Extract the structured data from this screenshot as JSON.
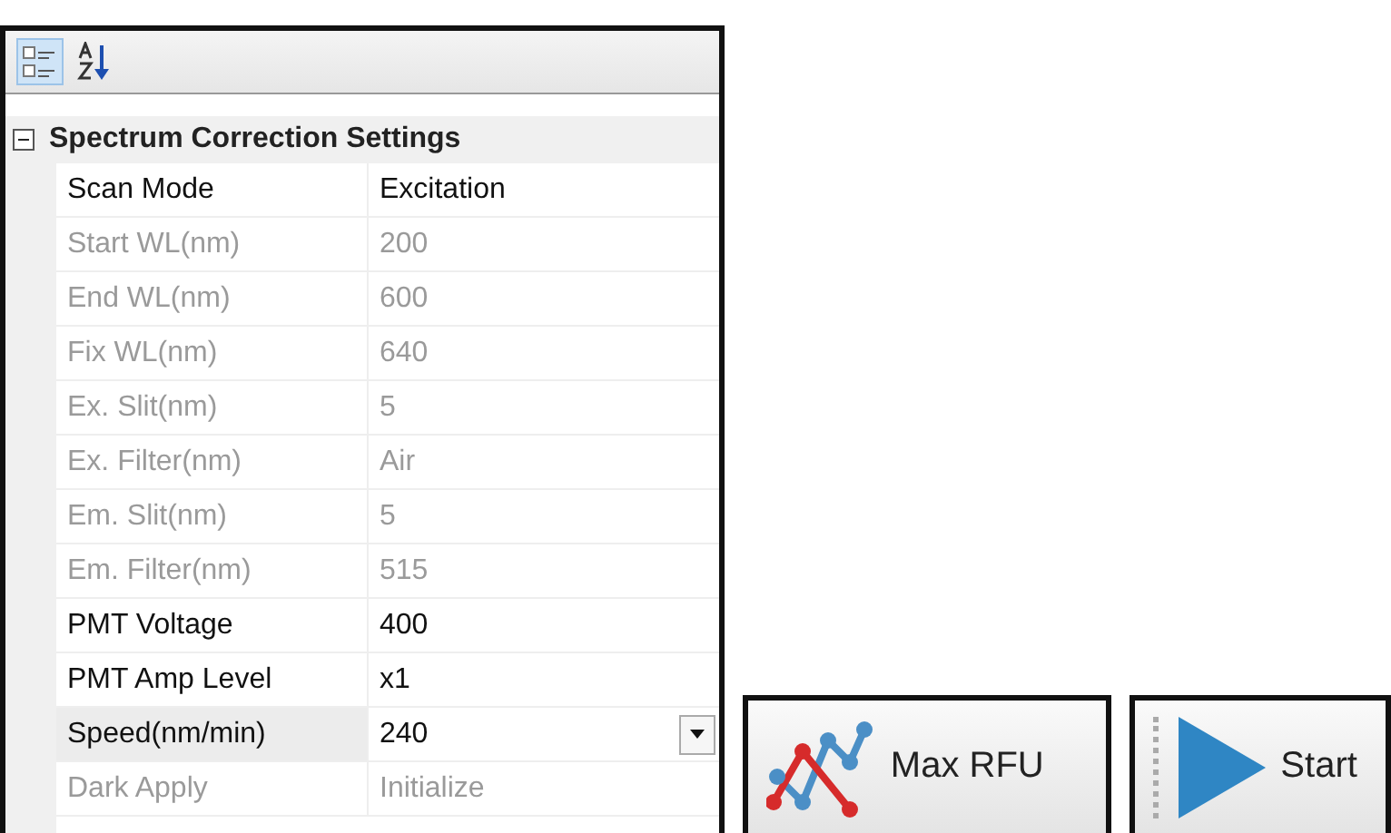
{
  "toolbar": {
    "buttons": [
      {
        "kind": "categorized",
        "selected": true
      },
      {
        "kind": "alphabetical",
        "selected": false
      }
    ]
  },
  "category": {
    "title": "Spectrum Correction Settings",
    "expanded": true
  },
  "properties": [
    {
      "name": "Scan Mode",
      "value": "Excitation",
      "disabled": false,
      "selected": false
    },
    {
      "name": "Start WL(nm)",
      "value": "200",
      "disabled": true,
      "selected": false
    },
    {
      "name": "End WL(nm)",
      "value": "600",
      "disabled": true,
      "selected": false
    },
    {
      "name": "Fix WL(nm)",
      "value": "640",
      "disabled": true,
      "selected": false
    },
    {
      "name": "Ex. Slit(nm)",
      "value": "5",
      "disabled": true,
      "selected": false
    },
    {
      "name": "Ex. Filter(nm)",
      "value": "Air",
      "disabled": true,
      "selected": false
    },
    {
      "name": "Em. Slit(nm)",
      "value": "5",
      "disabled": true,
      "selected": false
    },
    {
      "name": "Em. Filter(nm)",
      "value": "515",
      "disabled": true,
      "selected": false
    },
    {
      "name": "PMT Voltage",
      "value": "400",
      "disabled": false,
      "selected": false
    },
    {
      "name": "PMT Amp Level",
      "value": "x1",
      "disabled": false,
      "selected": false
    },
    {
      "name": "Speed(nm/min)",
      "value": "240",
      "disabled": false,
      "selected": true
    },
    {
      "name": "Dark Apply",
      "value": "Initialize",
      "disabled": true,
      "selected": false
    }
  ],
  "buttons": [
    {
      "kind": "max",
      "label": "Max RFU"
    },
    {
      "kind": "start",
      "label": "Start"
    }
  ]
}
